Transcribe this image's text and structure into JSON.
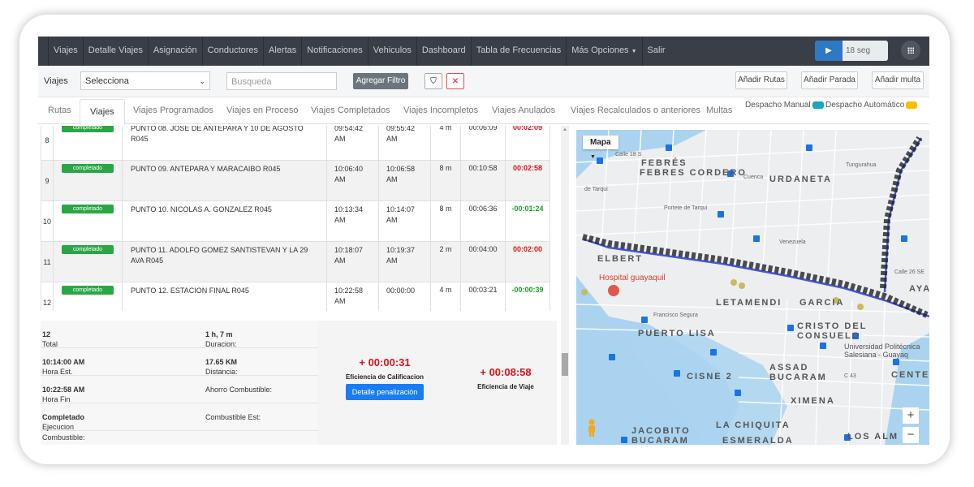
{
  "nav": {
    "items": [
      "Viajes",
      "Detalle Viajes",
      "Asignación",
      "Conductores",
      "Alertas",
      "Notificaciones",
      "Vehiculos",
      "Dashboard",
      "Tabla de Frecuencias",
      "Más Opciones",
      "Salir"
    ],
    "timer": "18 seg"
  },
  "filters": {
    "label": "Viajes",
    "select_value": "Selecciona",
    "search_placeholder": "Busqueda",
    "add_filter": "Agregar Filtro",
    "add_routes": "Añadir Rutas",
    "add_stop": "Añadir Parada",
    "add_fine": "Añadir multa"
  },
  "tabs": [
    "Rutas",
    "Viajes",
    "Viajes Programados",
    "Viajes en Proceso",
    "Viajes Completados",
    "Viajes Incompletos",
    "Viajes Anulados",
    "Viajes Recalculados o anteriores",
    "Multas"
  ],
  "despacho": {
    "manual": "Despacho Manual",
    "auto": "Despacho Automático",
    "manual_color": "#1ba7b5",
    "auto_color": "#f5c200"
  },
  "rows": [
    {
      "n": "8",
      "status": "completado",
      "punto": "PUNTO 08. JOSE DE ANTEPARA Y 10 DE AGOSTO R045",
      "est_time": "09:54:42",
      "est_ampm": "AM",
      "real_time": "09:55:42",
      "real_ampm": "AM",
      "mins": "4 m",
      "dur": "00:06:09",
      "diff": "00:02:09",
      "sign": "red"
    },
    {
      "n": "9",
      "status": "completado",
      "punto": "PUNTO 09. ANTEPARA Y MARACAIBO R045",
      "est_time": "10:06:40",
      "est_ampm": "AM",
      "real_time": "10:06:58",
      "real_ampm": "AM",
      "mins": "8 m",
      "dur": "00:10:58",
      "diff": "00:02:58",
      "sign": "red"
    },
    {
      "n": "10",
      "status": "completado",
      "punto": "PUNTO 10. NICOLAS A. GONZALEZ R045",
      "est_time": "10:13:34",
      "est_ampm": "AM",
      "real_time": "10:14:07",
      "real_ampm": "AM",
      "mins": "8 m",
      "dur": "00:06:36",
      "diff": "-00:01:24",
      "sign": "green"
    },
    {
      "n": "11",
      "status": "completado",
      "punto": "PUNTO 11. ADOLFO GOMEZ SANTISTEVAN Y LA 29 AVA R045",
      "est_time": "10:18:07",
      "est_ampm": "AM",
      "real_time": "10:19:37",
      "real_ampm": "AM",
      "mins": "2 m",
      "dur": "00:04:00",
      "diff": "00:02:00",
      "sign": "red"
    },
    {
      "n": "12",
      "status": "completado",
      "punto": "PUNTO 12. ESTACION FINAL R045",
      "est_time": "10:22:58",
      "est_ampm": "AM",
      "real_time": "00:00:00",
      "real_ampm": "",
      "mins": "4 m",
      "dur": "00:03:21",
      "diff": "-00:00:39",
      "sign": "green"
    }
  ],
  "summary": {
    "total_label": "Total de Tareas:",
    "total": "12",
    "duracion_label": "Duracion:",
    "duracion": "1 h, 7 m",
    "hora_est_label": "Hora Est. Fin Viaje:",
    "hora_est": "10:14:00 AM",
    "distancia_label": "Distancia:",
    "distancia": "17.65 KM",
    "hora_fin_label": "Hora Fin Viaje:",
    "hora_fin": "10:22:58 AM",
    "ahorro_label": "Ahorro Combustible:",
    "ejecucion_label": "Ejecucion Ruta:",
    "ejecucion": "Completado",
    "comb_est_label": "Combustible Est:",
    "comb_label": "Combustible:",
    "eff_calif": "+ 00:00:31",
    "eff_calif_label": "Eficiencia de Calificacion",
    "penalty_btn": "Detalle penalización",
    "eff_viaje": "+ 00:08:58",
    "eff_viaje_label": "Eficiencia de Viaje"
  },
  "map": {
    "type_label": "Mapa",
    "labels": [
      "FEBRES CORDERO",
      "URDANETA",
      "LETAMENDI",
      "GARCIA",
      "CRISTO DEL CONSUELO",
      "PUERTO LISA",
      "CISNE 2",
      "ASSAD BUCARAM",
      "XIMENA",
      "LA CHIQUITA",
      "JACOBITO BUCARAM",
      "ESMERALDA",
      "CENTEN",
      "AYA",
      "ELBERT",
      "LOS ALM"
    ],
    "streets": [
      "Calle 18 S",
      "Cuenca",
      "Portete de Tarqui",
      "Venezuela",
      "Calle 26 SE",
      "Francisco Segura",
      "de Tarqui",
      "Tungurahua",
      "C 43",
      "Universidad Politécnica Salesiana - Guayaq"
    ],
    "poi": "Hospital guayaquil",
    "zoom_in": "+",
    "zoom_out": "−"
  }
}
